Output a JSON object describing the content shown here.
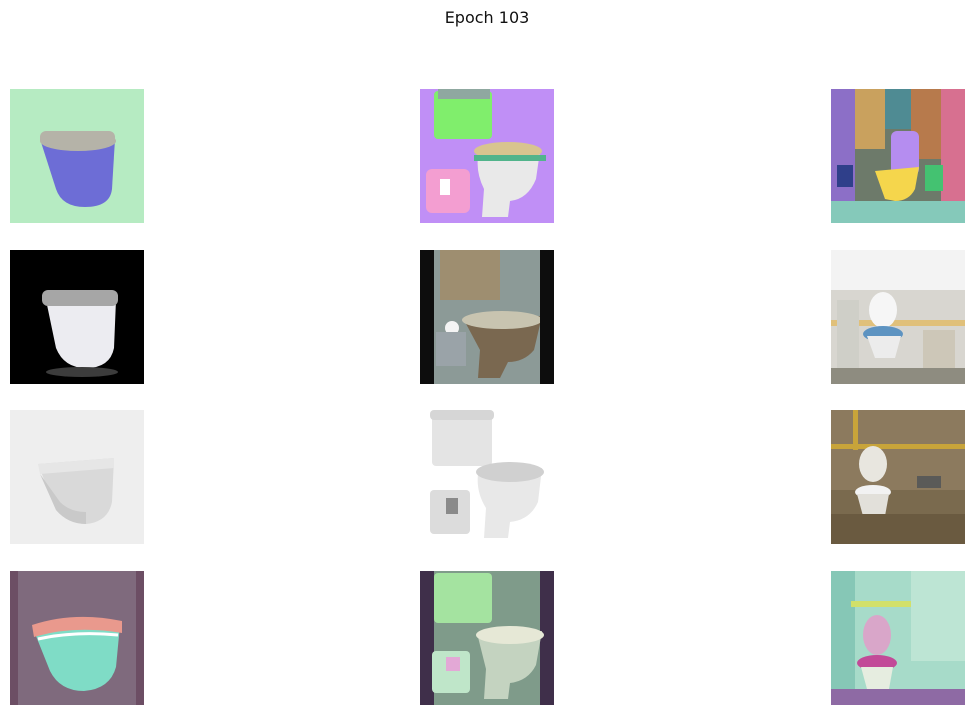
{
  "figure": {
    "title": "Epoch 103"
  },
  "grid": {
    "rows": 4,
    "cols": 3,
    "tiles": [
      {
        "row": 0,
        "col": 0,
        "subject": "toilet-semantic-map"
      },
      {
        "row": 0,
        "col": 1,
        "subject": "toilet-semantic-map"
      },
      {
        "row": 0,
        "col": 2,
        "subject": "bathroom-semantic-map"
      },
      {
        "row": 1,
        "col": 0,
        "subject": "toilet-generated"
      },
      {
        "row": 1,
        "col": 1,
        "subject": "toilet-generated"
      },
      {
        "row": 1,
        "col": 2,
        "subject": "bathroom-generated"
      },
      {
        "row": 2,
        "col": 0,
        "subject": "toilet-photo"
      },
      {
        "row": 2,
        "col": 1,
        "subject": "toilet-photo"
      },
      {
        "row": 2,
        "col": 2,
        "subject": "bathroom-photo"
      },
      {
        "row": 3,
        "col": 0,
        "subject": "toilet-reconstruction"
      },
      {
        "row": 3,
        "col": 1,
        "subject": "toilet-reconstruction"
      },
      {
        "row": 3,
        "col": 2,
        "subject": "bathroom-reconstruction"
      }
    ]
  }
}
